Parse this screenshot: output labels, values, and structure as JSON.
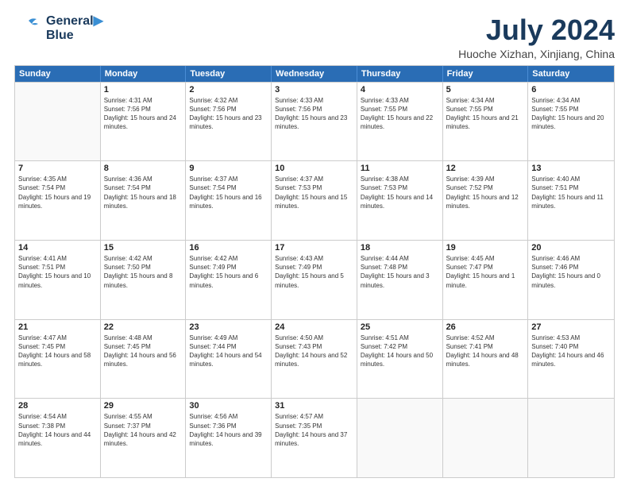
{
  "logo": {
    "line1": "General",
    "line2": "Blue",
    "tagline": ""
  },
  "title": "July 2024",
  "location": "Huoche Xizhan, Xinjiang, China",
  "days_header": [
    "Sunday",
    "Monday",
    "Tuesday",
    "Wednesday",
    "Thursday",
    "Friday",
    "Saturday"
  ],
  "weeks": [
    [
      {
        "day": "",
        "sunrise": "",
        "sunset": "",
        "daylight": "",
        "empty": true
      },
      {
        "day": "1",
        "sunrise": "Sunrise: 4:31 AM",
        "sunset": "Sunset: 7:56 PM",
        "daylight": "Daylight: 15 hours and 24 minutes."
      },
      {
        "day": "2",
        "sunrise": "Sunrise: 4:32 AM",
        "sunset": "Sunset: 7:56 PM",
        "daylight": "Daylight: 15 hours and 23 minutes."
      },
      {
        "day": "3",
        "sunrise": "Sunrise: 4:33 AM",
        "sunset": "Sunset: 7:56 PM",
        "daylight": "Daylight: 15 hours and 23 minutes."
      },
      {
        "day": "4",
        "sunrise": "Sunrise: 4:33 AM",
        "sunset": "Sunset: 7:55 PM",
        "daylight": "Daylight: 15 hours and 22 minutes."
      },
      {
        "day": "5",
        "sunrise": "Sunrise: 4:34 AM",
        "sunset": "Sunset: 7:55 PM",
        "daylight": "Daylight: 15 hours and 21 minutes."
      },
      {
        "day": "6",
        "sunrise": "Sunrise: 4:34 AM",
        "sunset": "Sunset: 7:55 PM",
        "daylight": "Daylight: 15 hours and 20 minutes."
      }
    ],
    [
      {
        "day": "7",
        "sunrise": "Sunrise: 4:35 AM",
        "sunset": "Sunset: 7:54 PM",
        "daylight": "Daylight: 15 hours and 19 minutes."
      },
      {
        "day": "8",
        "sunrise": "Sunrise: 4:36 AM",
        "sunset": "Sunset: 7:54 PM",
        "daylight": "Daylight: 15 hours and 18 minutes."
      },
      {
        "day": "9",
        "sunrise": "Sunrise: 4:37 AM",
        "sunset": "Sunset: 7:54 PM",
        "daylight": "Daylight: 15 hours and 16 minutes."
      },
      {
        "day": "10",
        "sunrise": "Sunrise: 4:37 AM",
        "sunset": "Sunset: 7:53 PM",
        "daylight": "Daylight: 15 hours and 15 minutes."
      },
      {
        "day": "11",
        "sunrise": "Sunrise: 4:38 AM",
        "sunset": "Sunset: 7:53 PM",
        "daylight": "Daylight: 15 hours and 14 minutes."
      },
      {
        "day": "12",
        "sunrise": "Sunrise: 4:39 AM",
        "sunset": "Sunset: 7:52 PM",
        "daylight": "Daylight: 15 hours and 12 minutes."
      },
      {
        "day": "13",
        "sunrise": "Sunrise: 4:40 AM",
        "sunset": "Sunset: 7:51 PM",
        "daylight": "Daylight: 15 hours and 11 minutes."
      }
    ],
    [
      {
        "day": "14",
        "sunrise": "Sunrise: 4:41 AM",
        "sunset": "Sunset: 7:51 PM",
        "daylight": "Daylight: 15 hours and 10 minutes."
      },
      {
        "day": "15",
        "sunrise": "Sunrise: 4:42 AM",
        "sunset": "Sunset: 7:50 PM",
        "daylight": "Daylight: 15 hours and 8 minutes."
      },
      {
        "day": "16",
        "sunrise": "Sunrise: 4:42 AM",
        "sunset": "Sunset: 7:49 PM",
        "daylight": "Daylight: 15 hours and 6 minutes."
      },
      {
        "day": "17",
        "sunrise": "Sunrise: 4:43 AM",
        "sunset": "Sunset: 7:49 PM",
        "daylight": "Daylight: 15 hours and 5 minutes."
      },
      {
        "day": "18",
        "sunrise": "Sunrise: 4:44 AM",
        "sunset": "Sunset: 7:48 PM",
        "daylight": "Daylight: 15 hours and 3 minutes."
      },
      {
        "day": "19",
        "sunrise": "Sunrise: 4:45 AM",
        "sunset": "Sunset: 7:47 PM",
        "daylight": "Daylight: 15 hours and 1 minute."
      },
      {
        "day": "20",
        "sunrise": "Sunrise: 4:46 AM",
        "sunset": "Sunset: 7:46 PM",
        "daylight": "Daylight: 15 hours and 0 minutes."
      }
    ],
    [
      {
        "day": "21",
        "sunrise": "Sunrise: 4:47 AM",
        "sunset": "Sunset: 7:45 PM",
        "daylight": "Daylight: 14 hours and 58 minutes."
      },
      {
        "day": "22",
        "sunrise": "Sunrise: 4:48 AM",
        "sunset": "Sunset: 7:45 PM",
        "daylight": "Daylight: 14 hours and 56 minutes."
      },
      {
        "day": "23",
        "sunrise": "Sunrise: 4:49 AM",
        "sunset": "Sunset: 7:44 PM",
        "daylight": "Daylight: 14 hours and 54 minutes."
      },
      {
        "day": "24",
        "sunrise": "Sunrise: 4:50 AM",
        "sunset": "Sunset: 7:43 PM",
        "daylight": "Daylight: 14 hours and 52 minutes."
      },
      {
        "day": "25",
        "sunrise": "Sunrise: 4:51 AM",
        "sunset": "Sunset: 7:42 PM",
        "daylight": "Daylight: 14 hours and 50 minutes."
      },
      {
        "day": "26",
        "sunrise": "Sunrise: 4:52 AM",
        "sunset": "Sunset: 7:41 PM",
        "daylight": "Daylight: 14 hours and 48 minutes."
      },
      {
        "day": "27",
        "sunrise": "Sunrise: 4:53 AM",
        "sunset": "Sunset: 7:40 PM",
        "daylight": "Daylight: 14 hours and 46 minutes."
      }
    ],
    [
      {
        "day": "28",
        "sunrise": "Sunrise: 4:54 AM",
        "sunset": "Sunset: 7:38 PM",
        "daylight": "Daylight: 14 hours and 44 minutes."
      },
      {
        "day": "29",
        "sunrise": "Sunrise: 4:55 AM",
        "sunset": "Sunset: 7:37 PM",
        "daylight": "Daylight: 14 hours and 42 minutes."
      },
      {
        "day": "30",
        "sunrise": "Sunrise: 4:56 AM",
        "sunset": "Sunset: 7:36 PM",
        "daylight": "Daylight: 14 hours and 39 minutes."
      },
      {
        "day": "31",
        "sunrise": "Sunrise: 4:57 AM",
        "sunset": "Sunset: 7:35 PM",
        "daylight": "Daylight: 14 hours and 37 minutes."
      },
      {
        "day": "",
        "sunrise": "",
        "sunset": "",
        "daylight": "",
        "empty": true
      },
      {
        "day": "",
        "sunrise": "",
        "sunset": "",
        "daylight": "",
        "empty": true
      },
      {
        "day": "",
        "sunrise": "",
        "sunset": "",
        "daylight": "",
        "empty": true
      }
    ]
  ]
}
